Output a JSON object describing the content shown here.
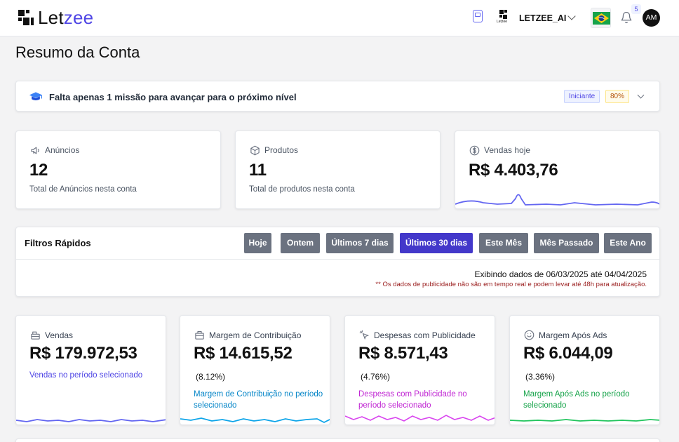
{
  "header": {
    "brand_prefix": "Let",
    "brand_suffix": "zee",
    "account_logo_caption": "Letzee",
    "account_name": "LETZEE_AI",
    "notification_count": "5",
    "avatar_initials": "AM",
    "icons": [
      "logo-mark",
      "document-icon",
      "chevron-down-icon",
      "brazil-flag-icon",
      "bell-icon"
    ]
  },
  "page": {
    "title": "Resumo da Conta"
  },
  "mission": {
    "text": "Falta apenas 1 missão para avançar para o próximo nível",
    "level_badge": "Iniciante",
    "progress_badge": "80%",
    "progress_value": 80
  },
  "stats": [
    {
      "label": "Anúncios",
      "value": "12",
      "desc": "Total de Anúncios nesta conta",
      "icon": "megaphone-icon"
    },
    {
      "label": "Produtos",
      "value": "11",
      "desc": "Total de produtos nesta conta",
      "icon": "box-icon"
    },
    {
      "label": "Vendas hoje",
      "value": "R$ 4.403,76",
      "desc": "",
      "icon": "dollar-icon"
    }
  ],
  "filters": {
    "title": "Filtros Rápidos",
    "buttons": [
      "Hoje",
      "Ontem",
      "Últimos 7 dias",
      "Últimos 30 dias",
      "Este Mês",
      "Mês Passado",
      "Este Ano"
    ],
    "active": "Últimos 30 dias",
    "range_text": "Exibindo dados de 06/03/2025 até 04/04/2025",
    "note": "** Os dados de publicidade não são em tempo real e podem levar até 48h para atualização."
  },
  "metrics": [
    {
      "label": "Vendas",
      "value": "R$ 179.972,53",
      "pct": "",
      "desc": "Vendas no período selecionado",
      "color": "#4f46e5",
      "icon": "cash-register-icon"
    },
    {
      "label": "Margem de Contribuição",
      "value": "R$ 14.615,52",
      "pct": "(8.12%)",
      "desc": "Margem de Contribuição no período selecionado",
      "color": "#0284c7",
      "icon": "briefcase-icon"
    },
    {
      "label": "Despesas com Publicidade",
      "value": "R$ 8.571,43",
      "pct": "(4.76%)",
      "desc": "Despesas com Publicidade no período selecionado",
      "color": "#c026d3",
      "icon": "click-icon"
    },
    {
      "label": "Margem Após Ads",
      "value": "R$ 6.044,09",
      "pct": "(3.36%)",
      "desc": "Margem Após Ads no período selecionado",
      "color": "#16a34a",
      "icon": "smile-icon"
    }
  ],
  "colors": {
    "accent": "#4338ca",
    "filter_button": "#6b7280",
    "vendas_line": "#6366f1",
    "margem_line": "#0ea5e9",
    "publicidade_line": "#d946ef",
    "apos_ads_line": "#22c55e"
  }
}
